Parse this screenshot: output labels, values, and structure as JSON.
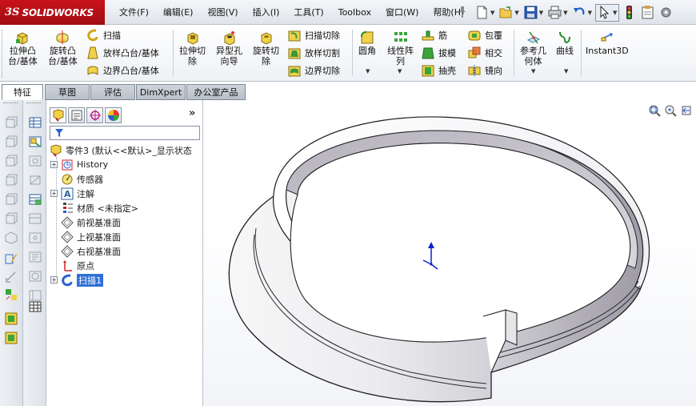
{
  "app": {
    "logo_ds": "3S",
    "logo_name": "SOLIDWORKS"
  },
  "menu": {
    "items": [
      "文件(F)",
      "编辑(E)",
      "视图(V)",
      "插入(I)",
      "工具(T)",
      "Toolbox",
      "窗口(W)",
      "帮助(H)"
    ]
  },
  "ribbon": {
    "extrude_boss": "拉伸凸\n台/基体",
    "revolve_boss": "旋转凸\n台/基体",
    "sweep": "扫描",
    "loft": "放样凸台/基体",
    "boundary_boss": "边界凸台/基体",
    "extrude_cut": "拉伸切\n除",
    "hole_wizard": "异型孔\n向导",
    "revolve_cut": "旋转切\n除",
    "sweep_cut": "扫描切除",
    "loft_cut": "放样切割",
    "boundary_cut": "边界切除",
    "fillet": "圆角",
    "linear_pattern": "线性阵\n列",
    "rib": "筋",
    "draft": "拔模",
    "shell": "抽壳",
    "wrap": "包覆",
    "intersect": "相交",
    "mirror": "镜向",
    "ref_geometry": "参考几\n何体",
    "curves": "曲线",
    "instant3d": "Instant3D"
  },
  "tabs": {
    "features": "特征",
    "sketch": "草图",
    "evaluate": "评估",
    "dimxpert": "DimXpert",
    "office": "办公室产品"
  },
  "tree": {
    "root": "零件3  (默认<<默认>_显示状态",
    "items": [
      {
        "label": "History",
        "expandable": true,
        "icon": "history-icon"
      },
      {
        "label": "传感器",
        "expandable": false,
        "icon": "sensor-icon"
      },
      {
        "label": "注解",
        "expandable": true,
        "icon": "annotation-icon"
      },
      {
        "label": "材质 <未指定>",
        "expandable": false,
        "icon": "material-icon"
      },
      {
        "label": "前视基准面",
        "expandable": false,
        "icon": "plane-icon"
      },
      {
        "label": "上视基准面",
        "expandable": false,
        "icon": "plane-icon"
      },
      {
        "label": "右视基准面",
        "expandable": false,
        "icon": "plane-icon"
      },
      {
        "label": "原点",
        "expandable": false,
        "icon": "origin-icon"
      },
      {
        "label": "扫描1",
        "expandable": true,
        "icon": "sweep-feature-icon",
        "selected": true
      }
    ]
  },
  "colors": {
    "logo_red": "#b3101a",
    "selection_blue": "#2f6fd6",
    "ring_light": "#f4f4f6",
    "ring_dark": "#9a96a0",
    "axis_blue": "#1020d0"
  }
}
